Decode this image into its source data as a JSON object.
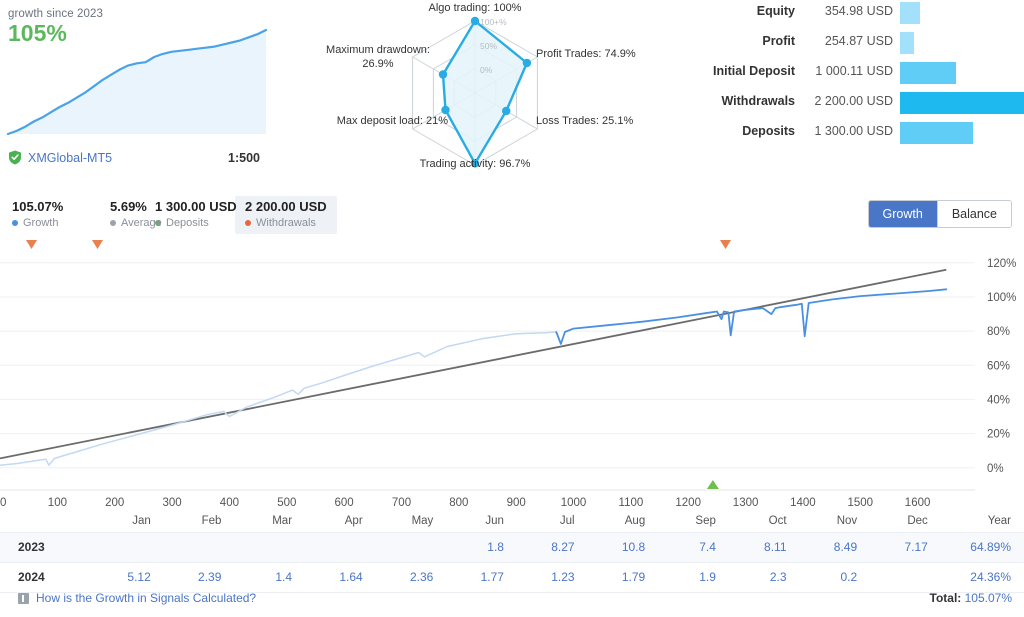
{
  "growth_card": {
    "caption": "growth since 2023",
    "growth_percent": "105%",
    "broker": "XMGlobal-MT5",
    "broker_icon": "verified-shield-icon",
    "leverage": "1:500",
    "sparkline": {
      "color": "#4aa3e8",
      "fill": "#eaf4fc",
      "points": [
        0,
        3,
        7,
        12,
        16,
        21,
        26,
        30,
        35,
        40,
        46,
        52,
        57,
        62,
        66,
        68,
        69,
        74,
        77,
        79,
        80,
        81,
        82,
        83,
        84,
        86,
        88,
        90,
        93,
        96,
        100
      ]
    }
  },
  "radar": {
    "ring_labels": [
      "0%",
      "50%",
      "100+%"
    ],
    "axes": [
      {
        "name": "algo-trading",
        "label": "Algo trading: 100%",
        "value": 100
      },
      {
        "name": "profit-trades",
        "label": "Profit Trades: 74.9%",
        "value": 74.9
      },
      {
        "name": "loss-trades",
        "label": "Loss Trades: 25.1%",
        "value": 25.1
      },
      {
        "name": "trading-activity",
        "label": "Trading activity: 96.7%",
        "value": 96.7
      },
      {
        "name": "max-deposit-load",
        "label": "Max deposit load: 21%",
        "value": 21
      },
      {
        "name": "maximum-drawdown",
        "label": "Maximum drawdown: 26.9%",
        "value": 26.9
      }
    ],
    "stroke": "#29ace3",
    "fill": "#e4f4fc",
    "grid": "#cdd3d8"
  },
  "stats": {
    "rows": [
      {
        "label": "Equity",
        "value": "354.98 USD",
        "ratio": 0.161,
        "color": "#a3e0fb"
      },
      {
        "label": "Profit",
        "value": "254.87 USD",
        "ratio": 0.116,
        "color": "#a3e0fb"
      },
      {
        "label": "Initial Deposit",
        "value": "1 000.11 USD",
        "ratio": 0.455,
        "color": "#5fcdf5"
      },
      {
        "label": "Withdrawals",
        "value": "2 200.00 USD",
        "ratio": 1.0,
        "color": "#1db9ef"
      },
      {
        "label": "Deposits",
        "value": "1 300.00 USD",
        "ratio": 0.591,
        "color": "#5fcdf5"
      }
    ]
  },
  "legend": {
    "items": [
      {
        "value": "105.07%",
        "name": "Growth",
        "color": "#4a90e2",
        "highlighted": false
      },
      {
        "value": "5.69%",
        "name": "Average",
        "color": "#9aa3ad",
        "highlighted": false
      },
      {
        "value": "1 300.00 USD",
        "name": "Deposits",
        "color": "#5cb85c",
        "highlighted": false
      },
      {
        "value": "2 200.00 USD",
        "name": "Withdrawals",
        "color": "#e8663d",
        "highlighted": true
      }
    ],
    "toggle": {
      "active": "Growth",
      "inactive": "Balance",
      "active_color": "#4a76c8"
    }
  },
  "chart_data": {
    "type": "line",
    "title": "",
    "xlabel": "",
    "ylabel": "",
    "xlim": [
      0,
      1700
    ],
    "ylim": [
      -6,
      124
    ],
    "xticks": [
      0,
      100,
      200,
      300,
      400,
      500,
      600,
      700,
      800,
      900,
      1000,
      1100,
      1200,
      1300,
      1400,
      1500,
      1600
    ],
    "yticks": [
      0,
      20,
      40,
      60,
      80,
      100,
      120
    ],
    "ytick_labels": [
      "0%",
      "20%",
      "40%",
      "60%",
      "80%",
      "100%",
      "120%"
    ],
    "grid": true,
    "legend_position": "top-left",
    "series": [
      {
        "name": "Growth",
        "color": "#4a90e2",
        "dim_color": "#c3d8f2",
        "x": [
          0,
          30,
          60,
          80,
          85,
          95,
          130,
          180,
          240,
          300,
          360,
          390,
          400,
          430,
          480,
          510,
          520,
          530,
          560,
          600,
          650,
          700,
          730,
          740,
          780,
          840,
          900,
          950,
          970,
          978,
          985,
          1000,
          1060,
          1120,
          1180,
          1230,
          1250,
          1258,
          1262,
          1270,
          1274,
          1280,
          1300,
          1330,
          1345,
          1352,
          1360,
          1390,
          1398,
          1403,
          1410,
          1450,
          1500,
          1560,
          1620,
          1650
        ],
        "y": [
          1.5,
          2.5,
          4.0,
          5.0,
          1.5,
          5.5,
          9.0,
          14.0,
          19.5,
          25.0,
          31.0,
          33.0,
          30.0,
          35.5,
          41.5,
          45.5,
          43.0,
          46.5,
          49.5,
          54.0,
          59.5,
          64.5,
          67.5,
          65.0,
          71.0,
          75.5,
          78.5,
          79.0,
          79.5,
          72.5,
          79.5,
          81.5,
          83.5,
          85.5,
          88.0,
          90.5,
          91.5,
          87.0,
          91.5,
          91.0,
          77.5,
          91.5,
          92.5,
          93.5,
          90.0,
          93.5,
          94.0,
          95.5,
          96.0,
          77.0,
          96.5,
          98.5,
          100.5,
          102.0,
          103.5,
          104.5
        ]
      },
      {
        "name": "Average",
        "color": "#6b6b6b",
        "x": [
          0,
          1650
        ],
        "y": [
          5.5,
          116.0
        ]
      }
    ],
    "markers": [
      {
        "type": "withdrawal",
        "shape": "triangle-down",
        "color": "#e8804f",
        "x": 55
      },
      {
        "type": "withdrawal",
        "shape": "triangle-down",
        "color": "#e8804f",
        "x": 170
      },
      {
        "type": "withdrawal",
        "shape": "triangle-down",
        "color": "#e8804f",
        "x": 1265
      },
      {
        "type": "deposit",
        "shape": "triangle-up",
        "color": "#6fbf4f",
        "x": 1243
      }
    ]
  },
  "monthly_table": {
    "columns": [
      "",
      "Jan",
      "Feb",
      "Mar",
      "Apr",
      "May",
      "Jun",
      "Jul",
      "Aug",
      "Sep",
      "Oct",
      "Nov",
      "Dec",
      "Year"
    ],
    "rows": [
      {
        "year": "2023",
        "values": [
          "",
          "",
          "",
          "",
          "",
          "1.8",
          "8.27",
          "10.8",
          "7.4",
          "8.11",
          "8.49",
          "7.17"
        ],
        "total": "64.89%"
      },
      {
        "year": "2024",
        "values": [
          "5.12",
          "2.39",
          "1.4",
          "1.64",
          "2.36",
          "1.77",
          "1.23",
          "1.79",
          "1.9",
          "2.3",
          "0.2",
          ""
        ],
        "total": "24.36%"
      }
    ]
  },
  "footer": {
    "help_link": "How is the Growth in Signals Calculated?",
    "total_label": "Total:",
    "total_value": "105.07%"
  }
}
